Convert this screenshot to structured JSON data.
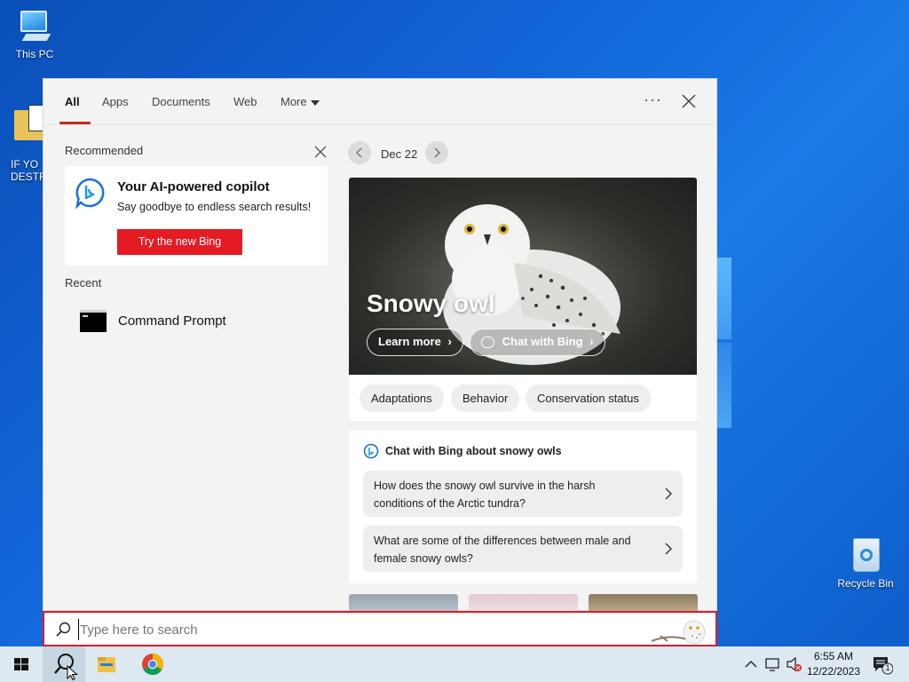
{
  "desktop": {
    "icons": [
      {
        "label": "This PC"
      },
      {
        "label": "IF YO\nDESTR"
      },
      {
        "label": "Recycle Bin"
      }
    ]
  },
  "search_panel": {
    "tabs": [
      {
        "label": "All",
        "active": true
      },
      {
        "label": "Apps"
      },
      {
        "label": "Documents"
      },
      {
        "label": "Web"
      },
      {
        "label": "More"
      }
    ],
    "more_options_icon": "ellipsis-icon",
    "close_icon": "close-icon",
    "recommended": {
      "heading": "Recommended",
      "card_title": "Your AI-powered copilot",
      "card_subtitle": "Say goodbye to endless search results!",
      "button_label": "Try the new Bing"
    },
    "recent": {
      "heading": "Recent",
      "items": [
        {
          "label": "Command Prompt",
          "icon": "command-prompt-icon"
        }
      ]
    },
    "highlight": {
      "date": "Dec 22",
      "title": "Snowy owl",
      "learn_more": "Learn more",
      "chat_with_bing": "Chat with Bing",
      "tags": [
        "Adaptations",
        "Behavior",
        "Conservation status"
      ],
      "chat_heading": "Chat with Bing about snowy owls",
      "questions": [
        "How does the snowy owl survive in the harsh conditions of the Arctic tundra?",
        "What are some of the differences between male and female snowy owls?"
      ]
    }
  },
  "search_box": {
    "placeholder": "Type here to search"
  },
  "taskbar": {
    "pinned": [
      "start-icon",
      "search-icon",
      "file-explorer-icon",
      "chrome-icon"
    ],
    "clock_time": "6:55 AM",
    "clock_date": "12/22/2023",
    "notification_count": "1"
  },
  "colors": {
    "accent_red": "#e51b24",
    "search_border": "#d21f2e",
    "tab_underline": "#c42b1c"
  }
}
